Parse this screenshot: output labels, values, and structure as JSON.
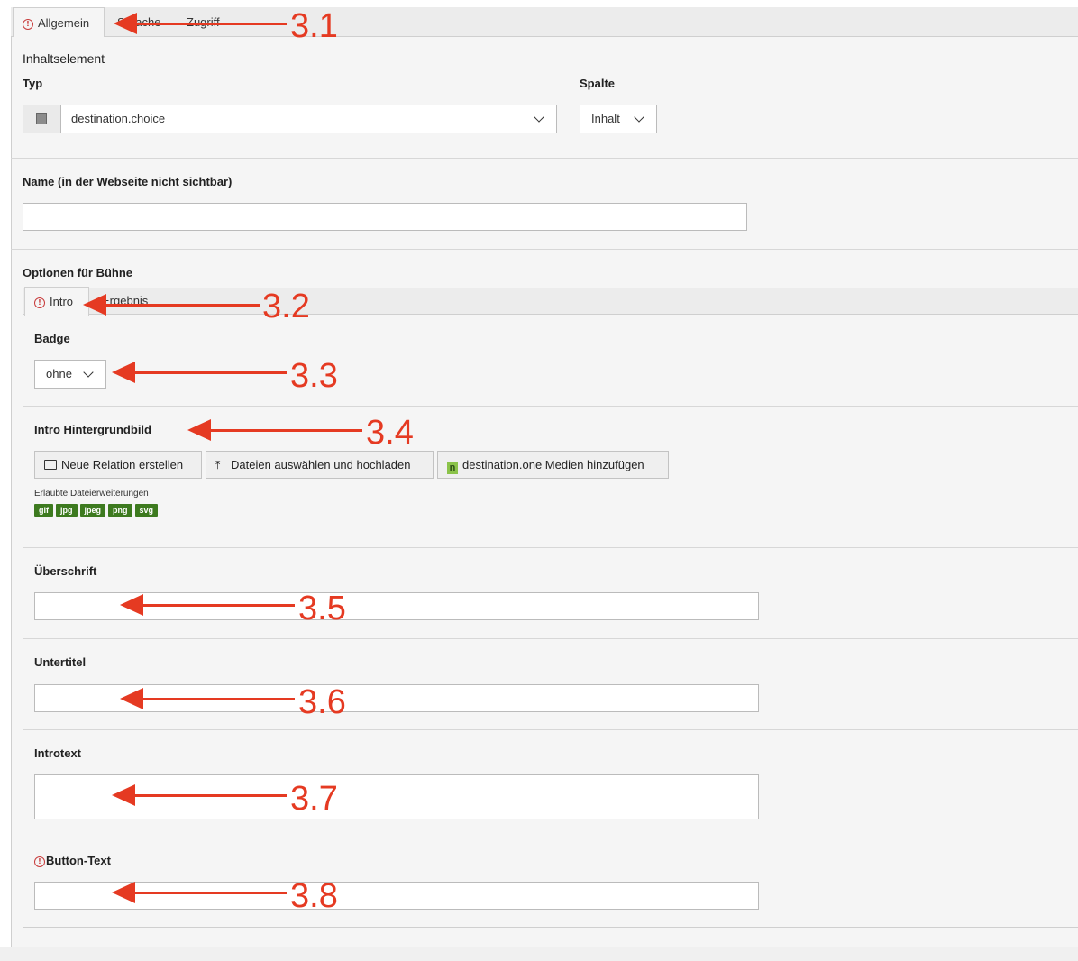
{
  "tabs": [
    {
      "label": "Allgemein"
    },
    {
      "label": "Sprache"
    },
    {
      "label": "Zugriff"
    }
  ],
  "header": {
    "title": "Inhaltselement"
  },
  "typ": {
    "label": "Typ",
    "value": "destination.choice"
  },
  "spalte": {
    "label": "Spalte",
    "value": "Inhalt"
  },
  "name": {
    "label": "Name (in der Webseite nicht sichtbar)",
    "value": ""
  },
  "options": {
    "label": "Optionen für Bühne",
    "tabs": [
      {
        "label": "Intro"
      },
      {
        "label": "Ergebnis"
      }
    ],
    "badge": {
      "label": "Badge",
      "value": "ohne"
    },
    "intro_bg": {
      "label": "Intro Hintergrundbild",
      "buttons": [
        "Neue Relation erstellen",
        "Dateien auswählen und hochladen",
        "destination.one Medien hinzufügen"
      ],
      "allowed_label": "Erlaubte Dateierweiterungen",
      "extensions": [
        "gif",
        "jpg",
        "jpeg",
        "png",
        "svg"
      ]
    },
    "ueberschrift": {
      "label": "Überschrift",
      "value": ""
    },
    "untertitel": {
      "label": "Untertitel",
      "value": ""
    },
    "introtext": {
      "label": "Introtext",
      "value": ""
    },
    "button_text": {
      "label": "Button-Text",
      "value": ""
    }
  },
  "annotations": [
    "3.1",
    "3.2",
    "3.3",
    "3.4",
    "3.5",
    "3.6",
    "3.7",
    "3.8"
  ],
  "colors": {
    "annotation": "#e53a22",
    "warning": "#c83c3c",
    "extension_badge": "#3d7a1f"
  },
  "icons": [
    "warning-icon",
    "chevron-down-icon",
    "folder-icon",
    "upload-icon",
    "destination-one-icon",
    "content-type-icon"
  ]
}
